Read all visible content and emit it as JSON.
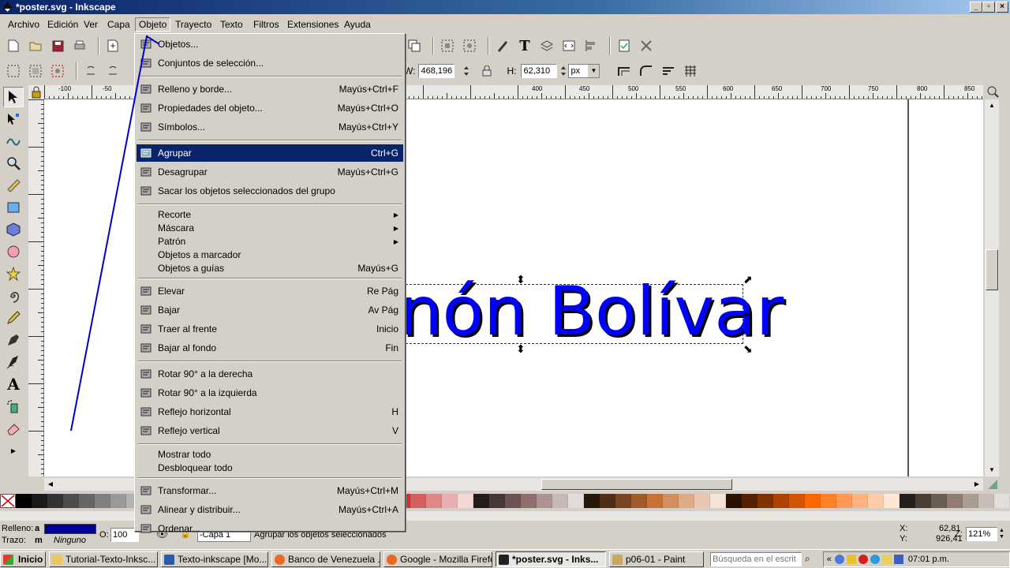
{
  "window": {
    "title": "*poster.svg - Inkscape"
  },
  "menubar": [
    "Archivo",
    "Edición",
    "Ver",
    "Capa",
    "Objeto",
    "Trayecto",
    "Texto",
    "Filtros",
    "Extensiones",
    "Ayuda"
  ],
  "toolcontrols": {
    "w_label": "W:",
    "w_value": "468,196",
    "h_label": "H:",
    "h_value": "62,310",
    "unit": "px"
  },
  "ruler": {
    "h_ticks": [
      "-100",
      "-50",
      "400",
      "450",
      "500",
      "550",
      "600",
      "650",
      "700",
      "750",
      "800",
      "850"
    ]
  },
  "canvas": {
    "text": "nón Bolívar",
    "text_color": "#0000ff"
  },
  "object_menu": {
    "items": [
      {
        "label": "Objetos...",
        "shortcut": "",
        "icon": "objects-icon"
      },
      {
        "label": "Conjuntos de selección...",
        "shortcut": "",
        "icon": "selection-sets-icon"
      },
      {
        "sep": true
      },
      {
        "label": "Relleno y borde...",
        "shortcut": "Mayús+Ctrl+F",
        "icon": "fill-stroke-icon"
      },
      {
        "label": "Propiedades del objeto...",
        "shortcut": "Mayús+Ctrl+O",
        "icon": "object-properties-icon"
      },
      {
        "label": "Símbolos...",
        "shortcut": "Mayús+Ctrl+Y",
        "icon": "symbols-icon"
      },
      {
        "sep": true
      },
      {
        "label": "Agrupar",
        "shortcut": "Ctrl+G",
        "icon": "group-icon",
        "highlighted": true
      },
      {
        "label": "Desagrupar",
        "shortcut": "Mayús+Ctrl+G",
        "icon": "ungroup-icon"
      },
      {
        "label": "Sacar los objetos seleccionados del grupo",
        "shortcut": "",
        "icon": "pop-from-group-icon"
      },
      {
        "sep": true
      },
      {
        "label": "Recorte",
        "shortcut": "",
        "submenu": true,
        "short": true
      },
      {
        "label": "Máscara",
        "shortcut": "",
        "submenu": true,
        "short": true
      },
      {
        "label": "Patrón",
        "shortcut": "",
        "submenu": true,
        "short": true
      },
      {
        "label": "Objetos a marcador",
        "shortcut": "",
        "short": true
      },
      {
        "label": "Objetos a guías",
        "shortcut": "Mayús+G",
        "short": true
      },
      {
        "sep": true
      },
      {
        "label": "Elevar",
        "shortcut": "Re Pág",
        "icon": "raise-icon"
      },
      {
        "label": "Bajar",
        "shortcut": "Av Pág",
        "icon": "lower-icon"
      },
      {
        "label": "Traer al frente",
        "shortcut": "Inicio",
        "icon": "raise-to-top-icon"
      },
      {
        "label": "Bajar al fondo",
        "shortcut": "Fin",
        "icon": "lower-to-bottom-icon"
      },
      {
        "sep": true
      },
      {
        "label": "Rotar 90° a la derecha",
        "shortcut": "",
        "icon": "rotate-cw-icon"
      },
      {
        "label": "Rotar 90° a la izquierda",
        "shortcut": "",
        "icon": "rotate-ccw-icon"
      },
      {
        "label": "Reflejo horizontal",
        "shortcut": "H",
        "icon": "flip-horizontal-icon"
      },
      {
        "label": "Reflejo vertical",
        "shortcut": "V",
        "icon": "flip-vertical-icon"
      },
      {
        "sep": true
      },
      {
        "label": "Mostrar todo",
        "shortcut": "",
        "short": true
      },
      {
        "label": "Desbloquear todo",
        "shortcut": "",
        "short": true
      },
      {
        "sep": true
      },
      {
        "label": "Transformar...",
        "shortcut": "Mayús+Ctrl+M",
        "icon": "transform-icon"
      },
      {
        "label": "Alinear y distribuir...",
        "shortcut": "Mayús+Ctrl+A",
        "icon": "align-distribute-icon"
      },
      {
        "label": "Ordenar...",
        "shortcut": "",
        "icon": "arrange-icon"
      }
    ]
  },
  "status": {
    "fill_label": "Relleno:",
    "fill_value": "a",
    "fill_color": "#000099",
    "stroke_label": "Trazo:",
    "stroke_value": "m",
    "stroke_none": "Ninguno",
    "opacity_label": "O:",
    "opacity_value": "100",
    "layer": "-Capa 1",
    "message": "Agrupar los objetos seleccionados",
    "x_label": "X:",
    "x_value": "62,81",
    "y_label": "Y:",
    "y_value": "926,41",
    "zoom_label": "Z:",
    "zoom_value": "121%"
  },
  "taskbar": {
    "start": "Inicio",
    "tasks": [
      "Tutorial-Texto-Inksc...",
      "Texto-inkscape [Mo...",
      "Banco de Venezuela ...",
      "Google - Mozilla Firefox",
      "*poster.svg - Inks...",
      "p06-01 - Paint"
    ],
    "search_placeholder": "Búsqueda en el escrit",
    "clock": "07:01 p.m."
  },
  "palette": [
    "#000000",
    "#1a1a1a",
    "#333333",
    "#4d4d4d",
    "#666666",
    "#808080",
    "#999999",
    "#b3b3b3",
    "#cccccc",
    "#e6e6e6",
    "#ffffff",
    "#800000",
    "#aa0000",
    "#d40000",
    "#ff0000",
    "#ff2a2a",
    "#ff5555",
    "#ff8080",
    "#ffaaaa",
    "#ffd5d5",
    "#280b0b",
    "#501616",
    "#782121",
    "#a02c2c",
    "#c83737",
    "#d35f5f",
    "#de8787",
    "#e9afaf",
    "#f4d7d7",
    "#241c1c",
    "#483737",
    "#6c5353",
    "#916f6f",
    "#ac9393",
    "#c8b7b7",
    "#e3dbdb",
    "#28170b",
    "#502d16",
    "#784421",
    "#a05a2c",
    "#c87137",
    "#d38d5f",
    "#deaa87",
    "#e9c6af",
    "#f4e3d7",
    "#2b1100",
    "#552200",
    "#803300",
    "#aa4400",
    "#d45500",
    "#ff6600",
    "#ff7f2a",
    "#ff9955",
    "#ffb380",
    "#ffccaa",
    "#ffe6d5",
    "#241f1c",
    "#483e37",
    "#6c5d53",
    "#917c6f",
    "#ac9d93",
    "#c8beb7",
    "#e3dedb"
  ]
}
